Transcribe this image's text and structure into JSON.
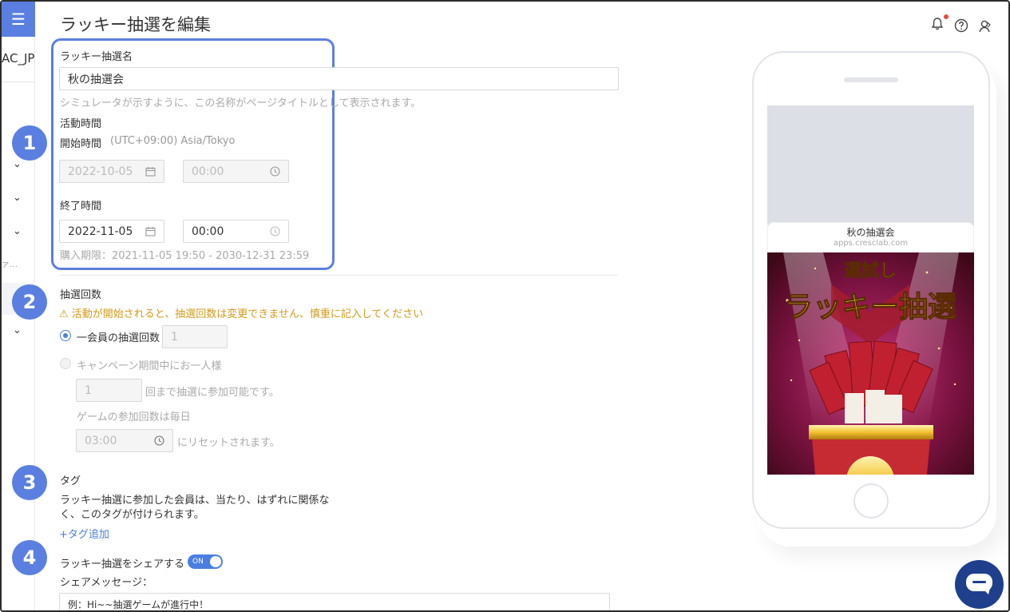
{
  "page": {
    "title": "ラッキー抽選を編集"
  },
  "rail": {
    "menu_icon": "hamburger-icon",
    "account_code": "AC_JP",
    "truncated_label": "ァ…"
  },
  "steps": [
    "1",
    "2",
    "3",
    "4"
  ],
  "form": {
    "name_label": "ラッキー抽選名",
    "name_value": "秋の抽選会",
    "name_hint": "シミュレータが示すように、この名称がページタイトルとして表示されます。",
    "period_label": "活動時間",
    "start_label": "開始時間",
    "timezone": "(UTC+09:00) Asia/Tokyo",
    "start_date": "2022-10-05",
    "start_time": "00:00",
    "end_label": "終了時間",
    "end_date": "2022-11-05",
    "end_time": "00:00",
    "purchase_limit": "購入期限：2021-11-05 19:50 - 2030-12-31 23:59",
    "draw_count_label": "抽選回数",
    "warning": "⚠ 活動が開始されると、抽選回数は変更できません、慎重に記入してください",
    "per_member_label": "一会員の抽選回数",
    "per_member_value": "1",
    "per_campaign_label": "キャンペーン期間中にお一人様",
    "per_campaign_value": "1",
    "per_campaign_suffix": "回まで抽選に参加可能です。",
    "daily_label": "ゲームの参加回数は毎日",
    "reset_time": "03:00",
    "reset_suffix": "にリセットされます。",
    "tag_label": "タグ",
    "tag_desc_1": "ラッキー抽選に参加した会員は、当たり、はずれに関係な",
    "tag_desc_2": "く、このタグが付けられます。",
    "add_tag": "+タグ追加",
    "share_label": "ラッキー抽選をシェアする",
    "share_toggle": "ON",
    "share_message_label": "シェアメッセージ：",
    "share_message_value": "例：Hi~~抽選ゲームが進行中！"
  },
  "preview": {
    "card_title": "秋の抽選会",
    "card_url": "apps.cresclab.com",
    "banner_top": "運試し",
    "banner_main": "ラッキー抽選"
  },
  "colors": {
    "accent": "#5b7fe0",
    "warning": "#d39a1b",
    "chat": "#1f3f8c",
    "notification": "#e74c3c"
  }
}
